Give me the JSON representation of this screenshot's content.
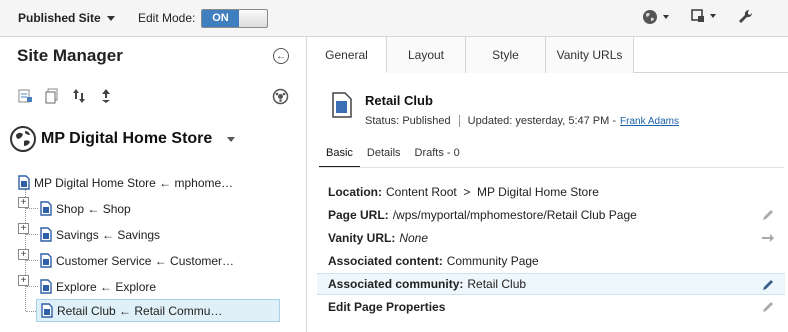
{
  "topbar": {
    "site_dropdown": "Published Site",
    "edit_mode_label": "Edit Mode:",
    "toggle_on": "ON"
  },
  "left": {
    "title": "Site Manager",
    "site_name": "MP Digital Home Store",
    "tree": [
      {
        "label": "MP Digital Home Store ← mphome…",
        "level": 0,
        "expandable": false
      },
      {
        "label": "Shop ← Shop",
        "level": 1,
        "expandable": true
      },
      {
        "label": "Savings ← Savings",
        "level": 1,
        "expandable": true
      },
      {
        "label": "Customer Service ← Customer…",
        "level": 1,
        "expandable": true
      },
      {
        "label": "Explore ← Explore",
        "level": 1,
        "expandable": true
      },
      {
        "label": "Retail Club ← Retail Commu…",
        "level": 1,
        "expandable": false,
        "selected": true
      }
    ]
  },
  "right": {
    "tabs": [
      "General",
      "Layout",
      "Style",
      "Vanity URLs"
    ],
    "active_tab": "General",
    "page_title": "Retail Club",
    "status_label": "Status:",
    "status_value": "Published",
    "updated_label": "Updated:",
    "updated_value": "yesterday, 5:47 PM",
    "updated_dash": "-",
    "author": "Frank Adams",
    "subtabs": [
      "Basic",
      "Details",
      "Drafts - 0"
    ],
    "props": {
      "location_label": "Location:",
      "location_value": "Content Root  >  MP Digital Home Store",
      "page_url_label": "Page URL:",
      "page_url_value": "/wps/myportal/mphomestore/Retail Club Page",
      "vanity_label": "Vanity URL:",
      "vanity_value": "None",
      "assoc_content_label": "Associated content:",
      "assoc_content_value": "Community Page",
      "assoc_community_label": "Associated community:",
      "assoc_community_value": "Retail Club",
      "edit_props_label": "Edit Page Properties"
    }
  },
  "colors": {
    "accent": "#3f7fbf",
    "link": "#1a5fa8",
    "selection": "#e0f0f8"
  }
}
